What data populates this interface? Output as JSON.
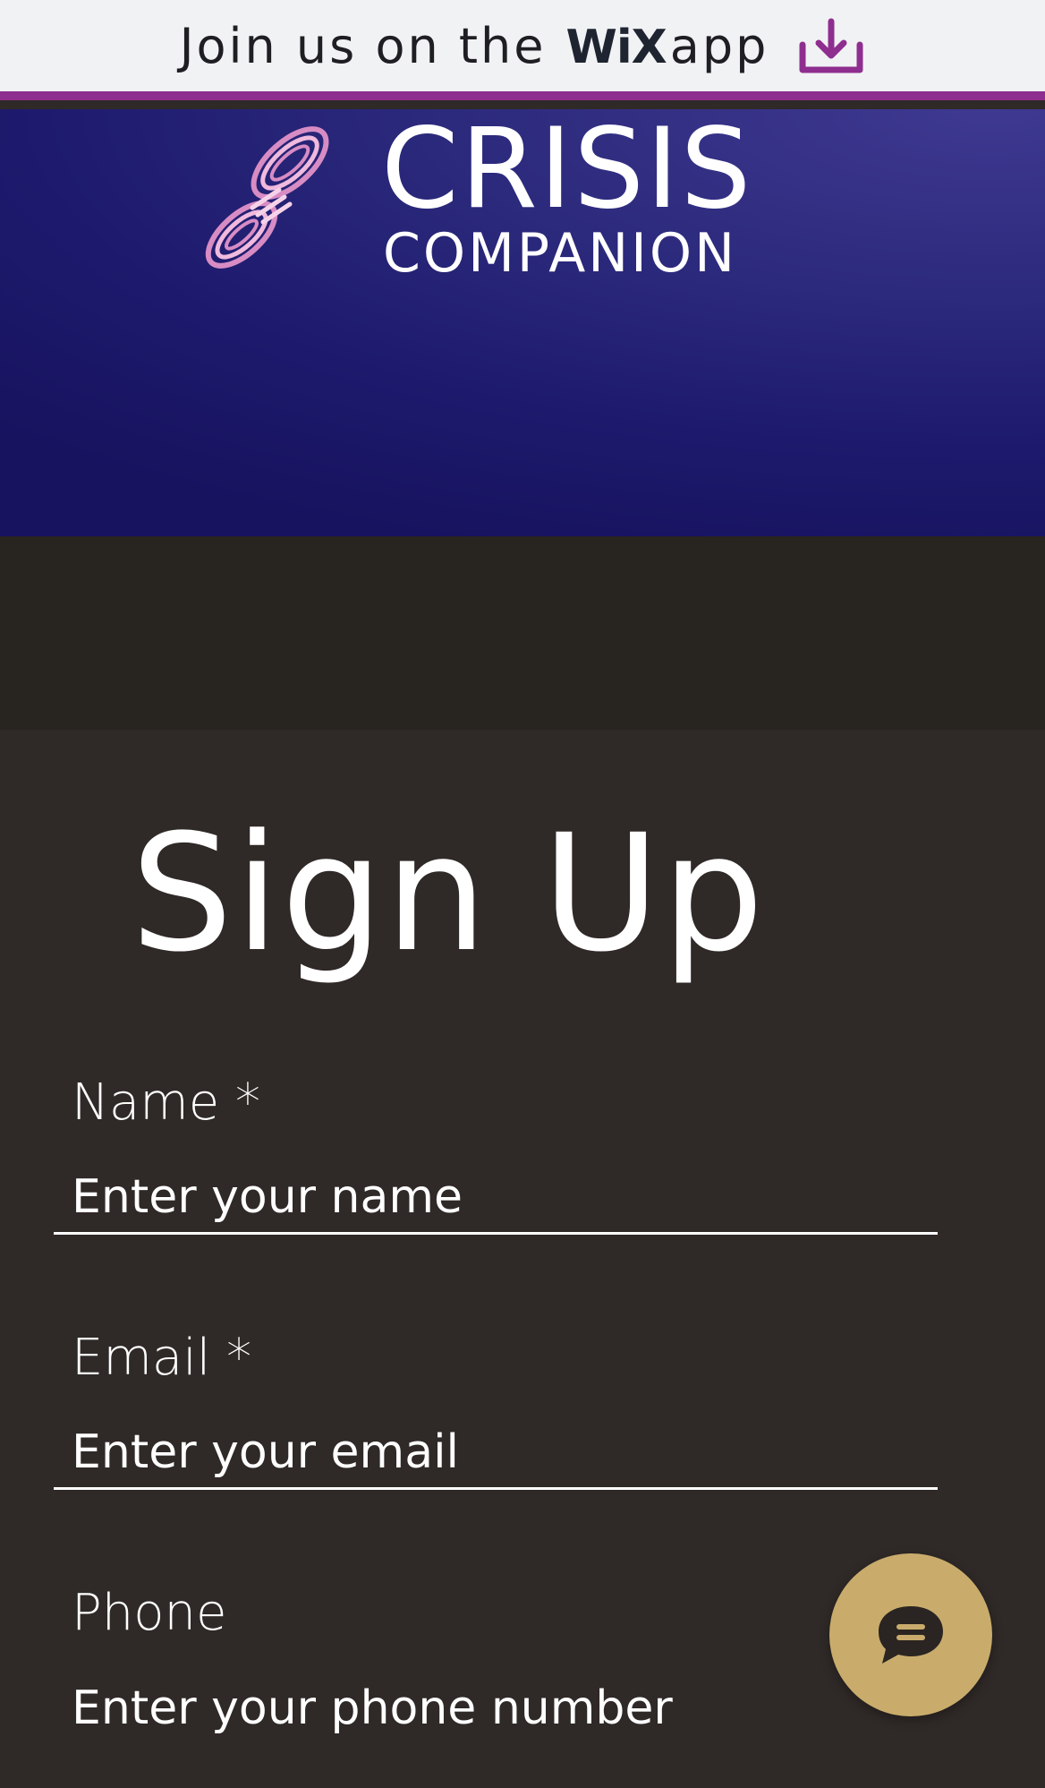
{
  "app_banner": {
    "prefix": "Join us on the",
    "brand": "WiX",
    "suffix": "app",
    "accent_color": "#8e2e8f",
    "icon": "download-icon"
  },
  "header": {
    "logo_line1": "CRISIS",
    "logo_line2": "COMPANION",
    "logo_icon": "rope-coil-icon",
    "background_color": "#1d1a6d"
  },
  "form": {
    "title": "Sign Up",
    "fields": [
      {
        "label": "Name *",
        "placeholder": "Enter your name"
      },
      {
        "label": "Email *",
        "placeholder": "Enter your email"
      },
      {
        "label": "Phone",
        "placeholder": "Enter your phone number"
      }
    ]
  },
  "chat": {
    "icon": "chat-bubble-icon",
    "button_color": "#c9ac6c"
  }
}
